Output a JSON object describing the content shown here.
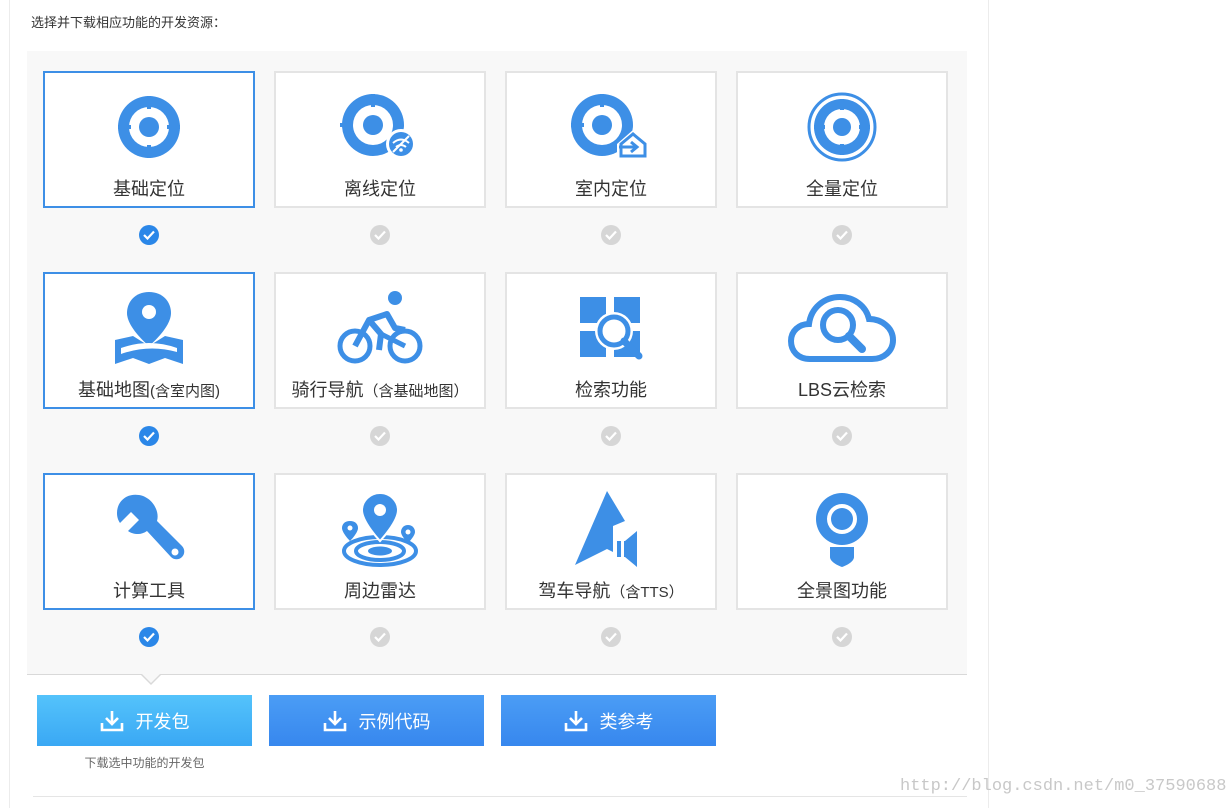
{
  "instruction": "选择并下载相应功能的开发资源：",
  "colors": {
    "accent": "#3d8fe6",
    "check_on": "#2b87e8",
    "check_off": "#d6d6d6"
  },
  "features": [
    {
      "label": "基础定位",
      "icon": "target-icon",
      "selected": true
    },
    {
      "label": "离线定位",
      "icon": "offline-location-icon",
      "selected": false
    },
    {
      "label": "室内定位",
      "icon": "indoor-location-icon",
      "selected": false
    },
    {
      "label": "全量定位",
      "icon": "full-location-icon",
      "selected": false
    },
    {
      "label": "基础地图",
      "label_suffix": "(含室内图)",
      "icon": "map-pin-icon",
      "selected": true
    },
    {
      "label": "骑行导航",
      "label_suffix": "（含基础地图）",
      "icon": "cyclist-icon",
      "selected": false
    },
    {
      "label": "检索功能",
      "icon": "search-grid-icon",
      "selected": false
    },
    {
      "label": "LBS云检索",
      "icon": "cloud-search-icon",
      "selected": false
    },
    {
      "label": "计算工具",
      "icon": "wrench-icon",
      "selected": true
    },
    {
      "label": "周边雷达",
      "icon": "radar-icon",
      "selected": false
    },
    {
      "label": "驾车导航",
      "label_suffix": "（含TTS）",
      "icon": "navigation-arrow-icon",
      "selected": false
    },
    {
      "label": "全景图功能",
      "icon": "panorama-icon",
      "selected": false
    }
  ],
  "buttons": {
    "sdk": "开发包",
    "demo": "示例代码",
    "ref": "类参考",
    "sdk_note": "下载选中功能的开发包"
  },
  "watermark": "http://blog.csdn.net/m0_37590688"
}
